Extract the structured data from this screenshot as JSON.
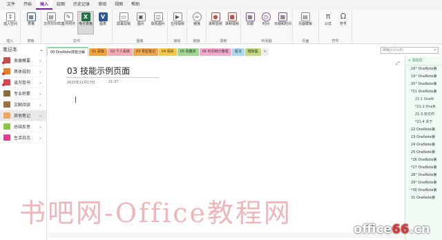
{
  "menubar": {
    "items": [
      "文件",
      "开始",
      "插入",
      "绘图",
      "历史记录",
      "审阅",
      "视图",
      "帮助"
    ],
    "active_index": 2
  },
  "ribbon": {
    "groups": [
      {
        "name": "插入",
        "buttons": [
          "插入空间"
        ]
      },
      {
        "name": "表格",
        "buttons": [
          "表格"
        ]
      },
      {
        "name": "文件",
        "buttons": [
          "文件打印样式",
          "文件附件",
          "电子表格",
          "图表"
        ]
      },
      {
        "name": "图像",
        "buttons": [
          "屏幕剪辑",
          "图片",
          "联机图片"
        ]
      },
      {
        "name": "媒体",
        "buttons": [
          "在线视频"
        ]
      },
      {
        "name": "链接",
        "buttons": [
          "链接"
        ]
      },
      {
        "name": "录制",
        "buttons": [
          "录制音频",
          "录制视频"
        ]
      },
      {
        "name": "时间戳",
        "buttons": [
          "日期",
          "时间",
          "日期和时间"
        ]
      },
      {
        "name": "页面",
        "buttons": [
          "页面模板"
        ]
      },
      {
        "name": "符号",
        "buttons": [
          "公式",
          "符号"
        ]
      }
    ],
    "selected_button": "电子表格"
  },
  "sidebar": {
    "title": "笔记本",
    "sections": [
      {
        "label": "发展概要",
        "color": "#c0504d",
        "dot": true
      },
      {
        "label": "具体规划",
        "color": "#e67e22",
        "dot": true
      },
      {
        "label": "读万卷书",
        "color": "#d64550",
        "dot": true
      },
      {
        "label": "专业积累",
        "color": "#8b6f3b"
      },
      {
        "label": "文献阅读",
        "color": "#9c6f3d"
      },
      {
        "label": "其他笔记",
        "color": "#f0a858",
        "active": true
      },
      {
        "label": "总结反思",
        "color": "#8cc63f"
      },
      {
        "label": "生活日志",
        "color": "#e63a8a"
      }
    ]
  },
  "tabs": [
    {
      "label": "00 OneNote技能分解",
      "color": "#8bd8a4",
      "active": true
    },
    {
      "label": "01 百篇",
      "color": "#f6a23a"
    },
    {
      "label": "02 个人系统",
      "color": "#f7a9b4"
    },
    {
      "label": "03 零星笔记",
      "color": "#f4a84a"
    },
    {
      "label": "04 相关",
      "color": "#f6c84a"
    },
    {
      "label": "05 收藏夹",
      "color": "#9ed78f"
    },
    {
      "label": "06 时间统计整理",
      "color": "#f6a8cf"
    },
    {
      "label": "看法",
      "color": "#a8d8f0"
    },
    {
      "label": "模板集",
      "color": "#c2d97a"
    },
    {
      "label": "+",
      "color": "#eeeeee",
      "add": true
    }
  ],
  "search": {
    "placeholder": "搜索(Ctrl+E)"
  },
  "page": {
    "title": "03 技能示例页面",
    "date": "2020年11月17日",
    "time": "21:37"
  },
  "pagelist": {
    "add_label": "+ 添加页",
    "items": [
      {
        "label": "18° OneNote第",
        "indent": 1
      },
      {
        "label": "19° OneNote第",
        "indent": 1
      },
      {
        "label": "20° OneNote第",
        "indent": 1
      },
      {
        "label": "*21 OneNote第",
        "indent": 1
      },
      {
        "label": "21-1 OneN",
        "indent": 2
      },
      {
        "label": "*21-2 OneN",
        "indent": 2
      },
      {
        "label": "21-3 安文件",
        "indent": 2
      },
      {
        "label": "*21-4 关于",
        "indent": 2
      },
      {
        "label": "22 OneNote第",
        "indent": 1
      },
      {
        "label": "23 OneNote第",
        "indent": 1
      },
      {
        "label": "24 OneNote第",
        "indent": 1
      },
      {
        "label": "25 OneNote第",
        "indent": 1
      },
      {
        "label": "*26 OneNote第",
        "indent": 1
      },
      {
        "label": "*27 OneNote第",
        "indent": 1
      },
      {
        "label": "28° OneNote第",
        "indent": 1
      },
      {
        "label": "29° OneNote第",
        "indent": 1
      },
      {
        "label": "*30 OneNote第",
        "indent": 1
      },
      {
        "label": "31 OneNote第",
        "indent": 1
      }
    ]
  },
  "watermark": {
    "text": "书吧网-Office教程网",
    "site_prefix": "office",
    "site_num": "66",
    "site_suffix": ".cn"
  }
}
